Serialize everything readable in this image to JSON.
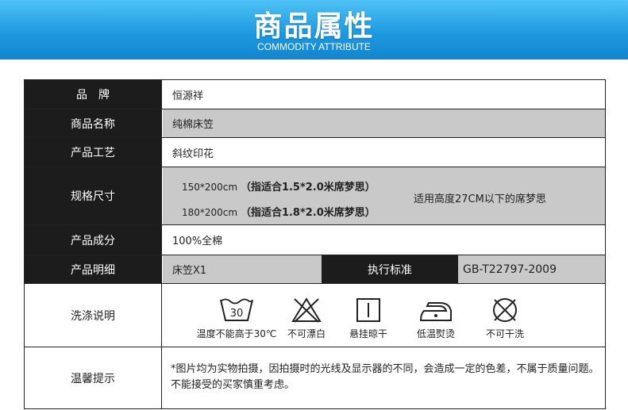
{
  "header": {
    "title": "商品属性",
    "subtitle": "COMMODITY ATTRIBUTE"
  },
  "rows": {
    "brand": {
      "label": "品　牌",
      "value": "恒源祥"
    },
    "name": {
      "label": "商品名称",
      "value": "纯棉床笠"
    },
    "craft": {
      "label": "产品工艺",
      "value": "斜纹印花"
    },
    "spec": {
      "label": "规格尺寸",
      "line1_size": "150*200cm",
      "line1_note": "（指适合1.5*2.0米席梦思）",
      "line2_size": "180*200cm",
      "line2_note": "（指适合1.8*2.0米席梦思）",
      "height_note": "适用高度27CM以下的席梦思"
    },
    "material": {
      "label": "产品成分",
      "value": "100%全棉"
    },
    "detail": {
      "label": "产品明细",
      "value": "床笠X1",
      "standard_label": "执行标准",
      "standard_value": "GB-T22797-2009"
    },
    "care": {
      "label": "洗涤说明",
      "items": [
        {
          "icon": "wash-30-icon",
          "temp": "30",
          "text": "温度不能高于30℃"
        },
        {
          "icon": "no-bleach-icon",
          "text": "不可漂白"
        },
        {
          "icon": "hang-dry-icon",
          "text": "悬挂晾干"
        },
        {
          "icon": "low-iron-icon",
          "text": "低温熨烫"
        },
        {
          "icon": "no-tumble-dry-icon",
          "text": "不可干洗"
        }
      ]
    },
    "notice": {
      "label": "温馨提示",
      "value": "*图片均为实物拍摄，因拍摄时的光线及显示器的不同，会造成一定的色差，不属于质量问题。不能接受的买家慎重考虑。"
    }
  }
}
